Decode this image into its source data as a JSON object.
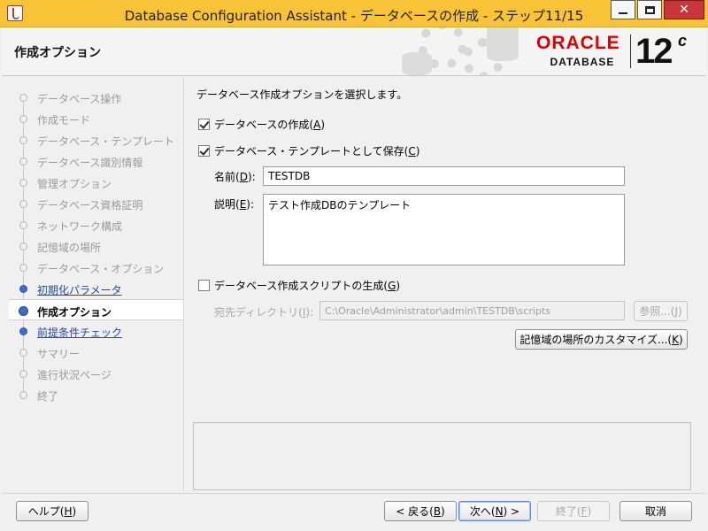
{
  "window": {
    "title": "Database Configuration Assistant - データベースの作成 - ステップ11/15",
    "close_glyph": "✕"
  },
  "header": {
    "title": "作成オプション",
    "logo_word": "ORACLE",
    "logo_sub": "DATABASE",
    "version": "12",
    "version_suffix": "c"
  },
  "steps": [
    {
      "label": "データベース操作",
      "state": "pending"
    },
    {
      "label": "作成モード",
      "state": "pending"
    },
    {
      "label": "データベース・テンプレート",
      "state": "pending"
    },
    {
      "label": "データベース識別情報",
      "state": "pending"
    },
    {
      "label": "管理オプション",
      "state": "pending"
    },
    {
      "label": "データベース資格証明",
      "state": "pending"
    },
    {
      "label": "ネットワーク構成",
      "state": "pending"
    },
    {
      "label": "記憶域の場所",
      "state": "pending"
    },
    {
      "label": "データベース・オプション",
      "state": "pending"
    },
    {
      "label": "初期化パラメータ",
      "state": "visited"
    },
    {
      "label": "作成オプション",
      "state": "current"
    },
    {
      "label": "前提条件チェック",
      "state": "visited"
    },
    {
      "label": "サマリー",
      "state": "pending"
    },
    {
      "label": "進行状況ページ",
      "state": "pending"
    },
    {
      "label": "終了",
      "state": "pending"
    }
  ],
  "main": {
    "description": "データベース作成オプションを選択します。",
    "create_db": {
      "text": "データベースの作成(",
      "key": "A",
      "end": ")",
      "checked": true
    },
    "save_template": {
      "text": "データベース・テンプレートとして保存(",
      "key": "C",
      "end": ")",
      "checked": true
    },
    "name": {
      "label": "名前(",
      "key": "D",
      "end": "):",
      "value": "TESTDB"
    },
    "desc_field": {
      "label": "説明(",
      "key": "E",
      "end": "):",
      "value": "テスト作成DBのテンプレート"
    },
    "gen_scripts": {
      "text": "データベース作成スクリプトの生成(",
      "key": "G",
      "end": ")",
      "checked": false
    },
    "dest_dir": {
      "label": "宛先ディレクトリ(",
      "key": "I",
      "end": "):",
      "value": "C:\\Oracle\\Administrator\\admin\\TESTDB\\scripts"
    },
    "browse": {
      "text": "参照...(",
      "key": "J",
      "end": ")"
    },
    "customize": {
      "text": "記憶域の場所のカスタマイズ...(",
      "key": "K",
      "end": ")"
    }
  },
  "footer": {
    "help": {
      "text": "ヘルプ(",
      "key": "H",
      "end": ")"
    },
    "back": {
      "text": "< 戻る(",
      "key": "B",
      "end": ")"
    },
    "next": {
      "text": "次へ(",
      "key": "N",
      "end": ") >"
    },
    "finish": {
      "text": "終了(",
      "key": "F",
      "end": ")"
    },
    "cancel": "取消"
  }
}
